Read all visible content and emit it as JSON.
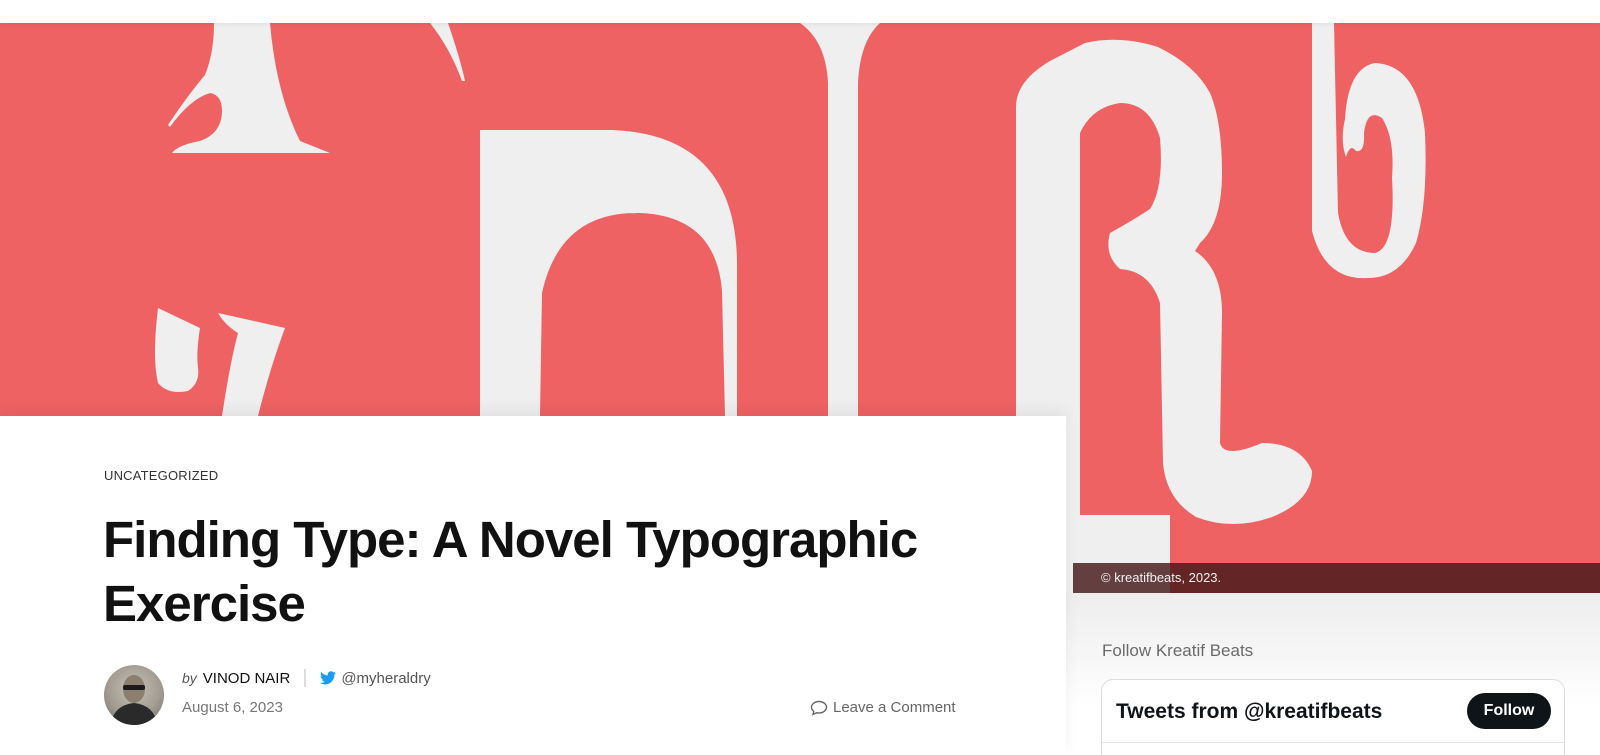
{
  "hero": {
    "background_color": "#ef6264",
    "glyph_color": "#efefef",
    "caption": "© kreatifbeats, 2023."
  },
  "article": {
    "category": "UNCATEGORIZED",
    "title": "Finding Type: A Novel Typographic Exercise",
    "byline_prefix": "by",
    "author": "VINOD NAIR",
    "twitter_handle": "@myheraldry",
    "date": "August 6, 2023",
    "comment_link": "Leave a Comment"
  },
  "sidebar": {
    "follow_title": "Follow Kreatif Beats",
    "tweets_title": "Tweets from @kreatifbeats",
    "follow_button": "Follow"
  },
  "icons": {
    "twitter": "twitter-bird-icon",
    "comment": "speech-bubble-icon"
  }
}
